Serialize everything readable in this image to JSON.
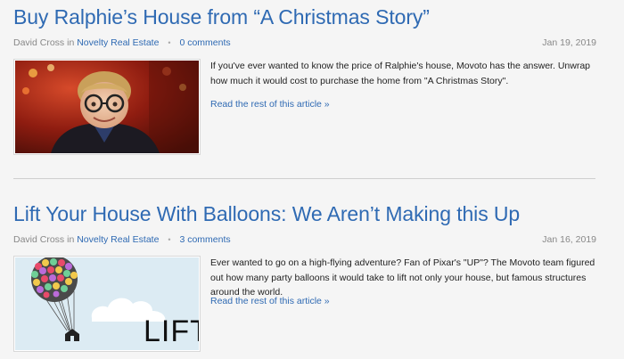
{
  "posts": [
    {
      "title": "Buy Ralphie’s House from “A Christmas Story”",
      "author": "David Cross",
      "in_text": "in",
      "category": "Novelty Real Estate",
      "comments": "0 comments",
      "date": "Jan 19, 2019",
      "excerpt": "If you've ever wanted to know the price of Ralphie's house, Movoto has the answer. Unwrap how much it would cost to purchase the home from \"A Christmas Story\".",
      "read_more": "Read the rest of this article »",
      "thumbnail_icon": "ralphie-photo"
    },
    {
      "title": "Lift Your House With Balloons: We Aren’t Making this Up",
      "author": "David Cross",
      "in_text": "in",
      "category": "Novelty Real Estate",
      "comments": "3 comments",
      "date": "Jan 16, 2019",
      "excerpt": "Ever wanted to go on a high-flying adventure? Fan of Pixar's \"UP\"? The Movoto team figured out how many party balloons it would take to lift not only your house, but famous structures around the world.",
      "read_more": "Read the rest of this article »",
      "thumbnail_icon": "balloon-house-illustration",
      "thumbnail_text": "LIFT"
    }
  ],
  "colors": {
    "link": "#2f6ab3",
    "meta": "#888888",
    "background": "#f5f5f5"
  }
}
